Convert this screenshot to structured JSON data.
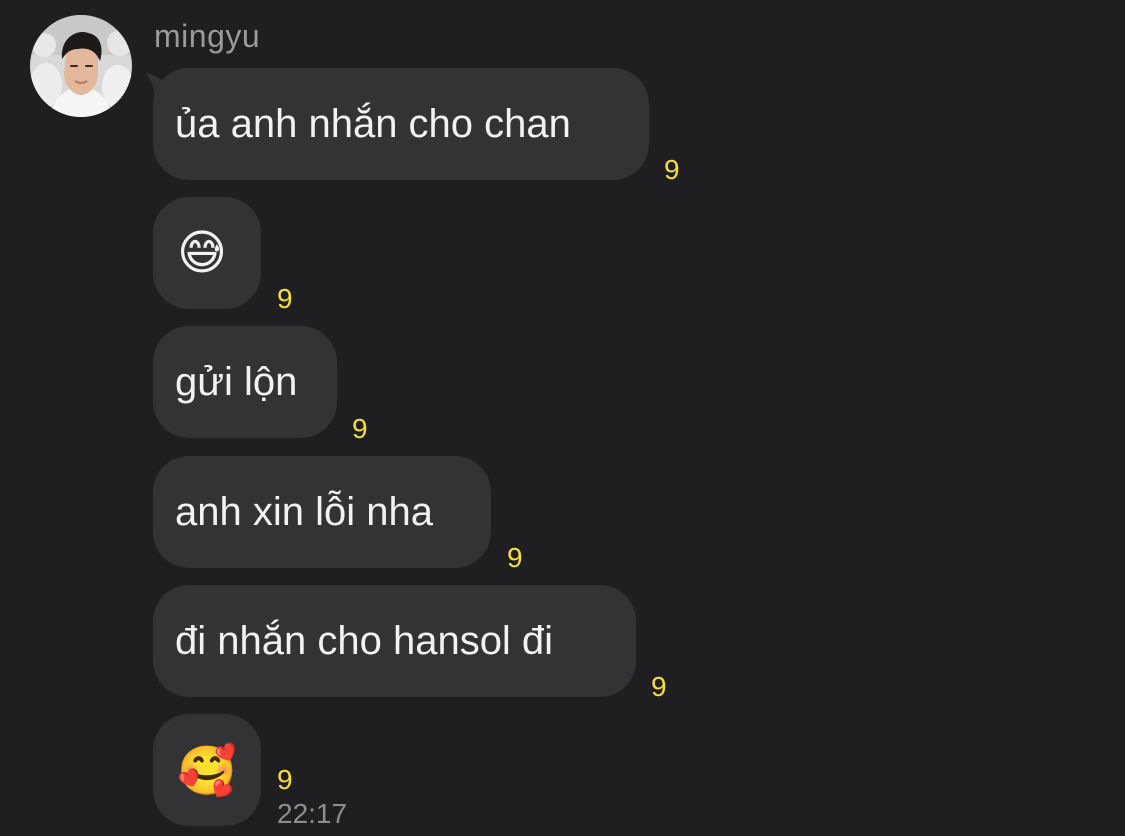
{
  "chat": {
    "sender_name": "mingyu",
    "messages": [
      {
        "text": "ủa anh nhắn cho chan",
        "unread": "9"
      },
      {
        "text": "😅",
        "unread": "9"
      },
      {
        "text": "gửi lộn",
        "unread": "9"
      },
      {
        "text": "anh xin lỗi nha",
        "unread": "9"
      },
      {
        "text": "đi nhắn cho hansol đi",
        "unread": "9"
      },
      {
        "text": "🥰",
        "unread": "9"
      }
    ],
    "last_time": "22:17"
  },
  "colors": {
    "background": "#1f1f21",
    "bubble": "#333336",
    "message_text": "#f2f2f2",
    "unread_count": "#f4de3c",
    "sender_name": "#9a9a9a",
    "timestamp": "#8e8e8e"
  },
  "icons": {
    "avatar": "profile-photo"
  }
}
